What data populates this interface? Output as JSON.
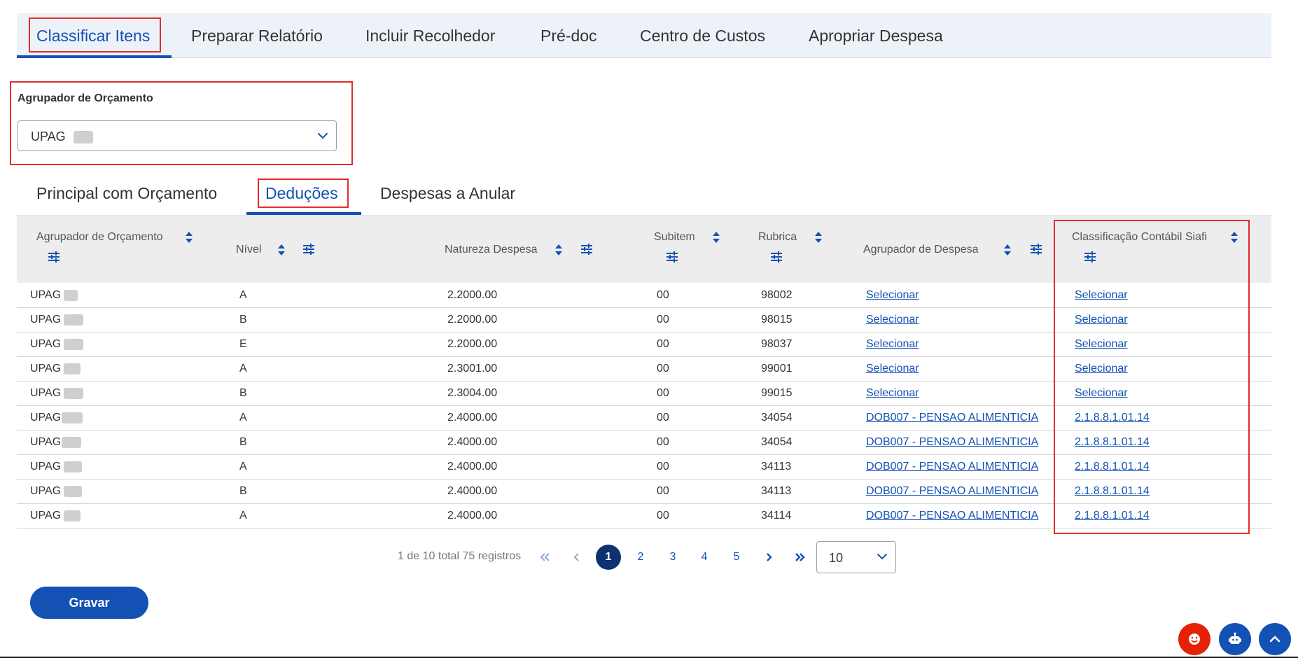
{
  "top_tabs": [
    {
      "label": "Classificar Itens",
      "active": true
    },
    {
      "label": "Preparar Relatório"
    },
    {
      "label": "Incluir Recolhedor"
    },
    {
      "label": "Pré-doc"
    },
    {
      "label": "Centro de Custos"
    },
    {
      "label": "Apropriar Despesa"
    }
  ],
  "filter": {
    "label": "Agrupador de Orçamento",
    "value": "UPAG"
  },
  "sub_tabs": [
    {
      "label": "Principal com Orçamento"
    },
    {
      "label": "Deduções",
      "active": true
    },
    {
      "label": "Despesas a Anular"
    }
  ],
  "table": {
    "headers": {
      "agrupador_orcamento": "Agrupador de Orçamento",
      "nivel": "Nível",
      "natureza": "Natureza Despesa",
      "subitem": "Subitem",
      "rubrica": "Rubrica",
      "agrupador_despesa": "Agrupador de Despesa",
      "classificacao": "Classificação Contábil Siafi"
    },
    "rows": [
      {
        "upag": "UPAG",
        "nivel": "A",
        "natureza": "2.2000.00",
        "subitem": "00",
        "rubrica": "98002",
        "agrupador_despesa": "Selecionar",
        "classificacao": "Selecionar"
      },
      {
        "upag": "UPAG",
        "nivel": "B",
        "natureza": "2.2000.00",
        "subitem": "00",
        "rubrica": "98015",
        "agrupador_despesa": "Selecionar",
        "classificacao": "Selecionar"
      },
      {
        "upag": "UPAG",
        "nivel": "E",
        "natureza": "2.2000.00",
        "subitem": "00",
        "rubrica": "98037",
        "agrupador_despesa": "Selecionar",
        "classificacao": "Selecionar"
      },
      {
        "upag": "UPAG",
        "nivel": "A",
        "natureza": "2.3001.00",
        "subitem": "00",
        "rubrica": "99001",
        "agrupador_despesa": "Selecionar",
        "classificacao": "Selecionar"
      },
      {
        "upag": "UPAG",
        "nivel": "B",
        "natureza": "2.3004.00",
        "subitem": "00",
        "rubrica": "99015",
        "agrupador_despesa": "Selecionar",
        "classificacao": "Selecionar"
      },
      {
        "upag": "UPAG",
        "nivel": "A",
        "natureza": "2.4000.00",
        "subitem": "00",
        "rubrica": "34054",
        "agrupador_despesa": "DOB007 - PENSAO ALIMENTICIA",
        "classificacao": "2.1.8.8.1.01.14"
      },
      {
        "upag": "UPAG",
        "nivel": "B",
        "natureza": "2.4000.00",
        "subitem": "00",
        "rubrica": "34054",
        "agrupador_despesa": "DOB007 - PENSAO ALIMENTICIA",
        "classificacao": "2.1.8.8.1.01.14"
      },
      {
        "upag": "UPAG",
        "nivel": "A",
        "natureza": "2.4000.00",
        "subitem": "00",
        "rubrica": "34113",
        "agrupador_despesa": "DOB007 - PENSAO ALIMENTICIA",
        "classificacao": "2.1.8.8.1.01.14"
      },
      {
        "upag": "UPAG",
        "nivel": "B",
        "natureza": "2.4000.00",
        "subitem": "00",
        "rubrica": "34113",
        "agrupador_despesa": "DOB007 - PENSAO ALIMENTICIA",
        "classificacao": "2.1.8.8.1.01.14"
      },
      {
        "upag": "UPAG",
        "nivel": "A",
        "natureza": "2.4000.00",
        "subitem": "00",
        "rubrica": "34114",
        "agrupador_despesa": "DOB007 - PENSAO ALIMENTICIA",
        "classificacao": "2.1.8.8.1.01.14"
      }
    ]
  },
  "pagination": {
    "info": "1 de 10 total 75 registros",
    "pages": [
      "1",
      "2",
      "3",
      "4",
      "5"
    ],
    "current_page": "1",
    "per_page": "10"
  },
  "actions": {
    "save_label": "Gravar"
  },
  "colors": {
    "primary": "#1351b4",
    "dark_primary": "#0c326f",
    "highlight": "#e52b2b",
    "feedback_fab": "#e52207"
  },
  "icons": {
    "sort": "sort-icon",
    "filter": "filter-sliders-icon",
    "chevron": "chevron-down-icon",
    "fab": [
      "smiley-icon",
      "robot-icon",
      "chevron-up-icon"
    ]
  }
}
